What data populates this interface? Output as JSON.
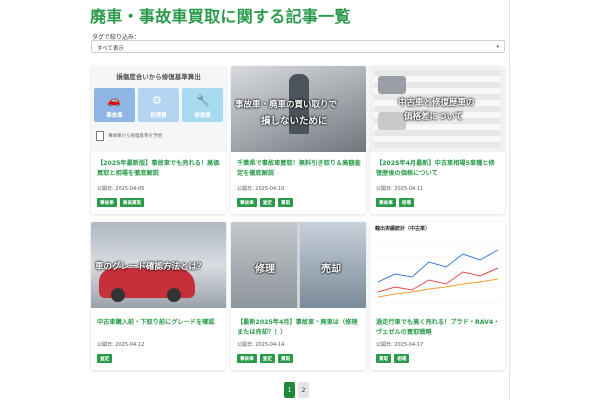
{
  "page": {
    "title": "廃車・事故車買取に関する記事一覧",
    "filter_label": "タグで絞り込み：",
    "filter_value": "すべて表示"
  },
  "cards": [
    {
      "title": "【2025年最新版】事故車でも売れる！高価買取と相場を徹底解説",
      "date": "公開日: 2025-04-05",
      "tags": [
        "事故車",
        "高価買取"
      ],
      "thumb": {
        "heading": "損傷度合いから修復基準算出",
        "boxes": [
          "事故車",
          "修理費",
          "修復車"
        ],
        "note": "事故車から修復基準を予想"
      }
    },
    {
      "title": "千葉県で事故車買取！無料引き取り＆高額査定を徹底解説",
      "date": "公開日: 2025-04-10",
      "tags": [
        "事故車",
        "査定",
        "買取"
      ],
      "thumb": {
        "overlay": [
          "事故車・廃車の買い取りで",
          "損しないために"
        ]
      }
    },
    {
      "title": "【2025年4月最新】中古車相場5車種と修復歴後の価格について",
      "date": "公開日: 2025-04-11",
      "tags": [
        "事故車",
        "相場"
      ],
      "thumb": {
        "overlay": [
          "中古車と修復歴車の",
          "価格差について"
        ]
      }
    },
    {
      "title": "中古車購入前・下取り前にグレードを確認",
      "date": "公開日: 2025-04-12",
      "tags": [
        "査定"
      ],
      "thumb": {
        "overlay": [
          "車のグレード確認方法とは？"
        ]
      }
    },
    {
      "title": "【最新2025年4月】事故車・廃車は（修理または売却？！）",
      "date": "公開日: 2025-04-14",
      "tags": [
        "事故車",
        "査定",
        "買取"
      ],
      "thumb": {
        "overlay": [
          "修理",
          "売却"
        ]
      }
    },
    {
      "title": "過走行車でも高く売れる！プラド・RAV4・ヴェゼルの買取戦略",
      "date": "公開日: 2025-04-17",
      "tags": [
        "買取",
        "相場"
      ],
      "thumb": {
        "heading": "輸出実績統計（中古車）"
      }
    }
  ],
  "pagination": [
    "1",
    "2"
  ],
  "colors": {
    "accent": "#2a9a4a",
    "active_page": "#1f8a3c"
  }
}
